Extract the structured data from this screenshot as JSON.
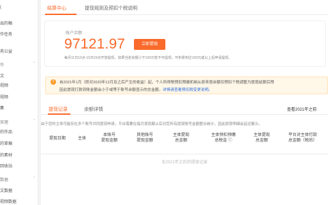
{
  "sidebar": {
    "items": [
      {
        "label": "(",
        "kind": "item"
      },
      {
        "label": "出的稿",
        "kind": "item"
      },
      {
        "label": "作任务",
        "kind": "item"
      },
      {
        "label": "务公益",
        "kind": "item"
      },
      {
        "label": "作",
        "kind": "group"
      },
      {
        "label": "文",
        "kind": "item"
      },
      {
        "label": "视频",
        "kind": "item"
      },
      {
        "label": "视频",
        "kind": "item"
      },
      {
        "label": "集",
        "kind": "item"
      },
      {
        "label": "官理",
        "kind": "group"
      },
      {
        "label": "的作品",
        "kind": "item"
      },
      {
        "label": "的草稿",
        "kind": "item"
      },
      {
        "label": "的素材",
        "kind": "item"
      },
      {
        "label": "回收站",
        "kind": "item"
      },
      {
        "label": "数据",
        "kind": "group"
      },
      {
        "label": "文数据",
        "kind": "item"
      },
      {
        "label": "视频数据",
        "kind": "item"
      }
    ]
  },
  "tabs": [
    "结算中心",
    "提现规则及预扣个税说明"
  ],
  "balance": {
    "label": "账户余额",
    "amount": "97121.97",
    "withdraw_label": "立即提现",
    "note": "每月11日10点-15日23点开放提现，如果当前余额小于100元暂不可提现，可积累到达100元或以上后申请提现。"
  },
  "notice": {
    "icon": "!",
    "line1": "自2021年1月（即对2020年12月及之后产生的收益）起，个人所得税预扣预缴机制从原来按余额扣预扣个税调整为提现结算后预",
    "line2_prefix": "因此提现打款到账金额会小于或等于账号余额显示的总金额。",
    "line2_link": "详情请查看预扣税变更说明。"
  },
  "sub_tabs": [
    "提现记录",
    "余额详情"
  ],
  "history_link": "查看2021年之前",
  "info_line": "由于您的主体可能存在多个账号共同提现申请，平台需要在每月提现截止后对您所有提现账号金额整合统计，因此提现明细会延迟展示。",
  "table": {
    "headers": [
      [
        "提现日期"
      ],
      [
        "主体"
      ],
      [
        "本账号",
        "提现金额"
      ],
      [
        "其他账号",
        "提现金额"
      ],
      [
        "主体提现",
        "总金额"
      ],
      [
        "主体预扣预缴",
        "总税金 ⓘ"
      ],
      [
        "主体提现",
        "总金额"
      ],
      [
        "平台对主体打款",
        "总金额（税后）"
      ]
    ],
    "empty_text": "无2021年之后的提现记录"
  }
}
